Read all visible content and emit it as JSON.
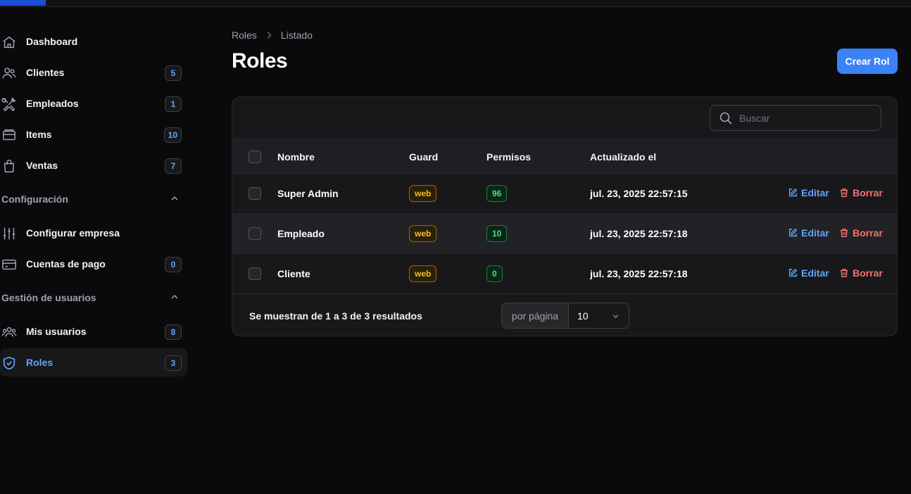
{
  "colors": {
    "accent": "#3b82f6",
    "badge_text": "#60a5fa",
    "guard_badge": "#fbbf24",
    "permission_badge": "#4ade80",
    "delete": "#f87171",
    "background": "#0a0a0c"
  },
  "sidebar": {
    "items": [
      {
        "label": "Dashboard",
        "icon": "home-icon"
      },
      {
        "label": "Clientes",
        "icon": "users-icon",
        "count": "5"
      },
      {
        "label": "Empleados",
        "icon": "tools-icon",
        "count": "1"
      },
      {
        "label": "Items",
        "icon": "box-icon",
        "count": "10"
      },
      {
        "label": "Ventas",
        "icon": "shopping-bag-icon",
        "count": "7"
      }
    ],
    "groups": [
      {
        "label": "Configuración",
        "items": [
          {
            "label": "Configurar empresa",
            "icon": "sliders-icon"
          },
          {
            "label": "Cuentas de pago",
            "icon": "credit-card-icon",
            "count": "0"
          }
        ]
      },
      {
        "label": "Gestión de usuarios",
        "items": [
          {
            "label": "Mis usuarios",
            "icon": "user-group-icon",
            "count": "8"
          },
          {
            "label": "Roles",
            "icon": "shield-check-icon",
            "count": "3",
            "active": true
          }
        ]
      }
    ]
  },
  "breadcrumb": [
    "Roles",
    "Listado"
  ],
  "page_title": "Roles",
  "create_button": "Crear Rol",
  "search": {
    "placeholder": "Buscar",
    "value": ""
  },
  "table": {
    "headers": [
      "Nombre",
      "Guard",
      "Permisos",
      "Actualizado el"
    ],
    "rows": [
      {
        "name": "Super Admin",
        "guard": "web",
        "permissions": "96",
        "updated": "jul. 23, 2025 22:57:15"
      },
      {
        "name": "Empleado",
        "guard": "web",
        "permissions": "10",
        "updated": "jul. 23, 2025 22:57:18"
      },
      {
        "name": "Cliente",
        "guard": "web",
        "permissions": "0",
        "updated": "jul. 23, 2025 22:57:18"
      }
    ],
    "actions": {
      "edit": "Editar",
      "delete": "Borrar"
    }
  },
  "pagination": {
    "results_text": "Se muestran de 1 a 3 de 3 resultados",
    "per_page_label": "por página",
    "per_page_value": "10"
  }
}
